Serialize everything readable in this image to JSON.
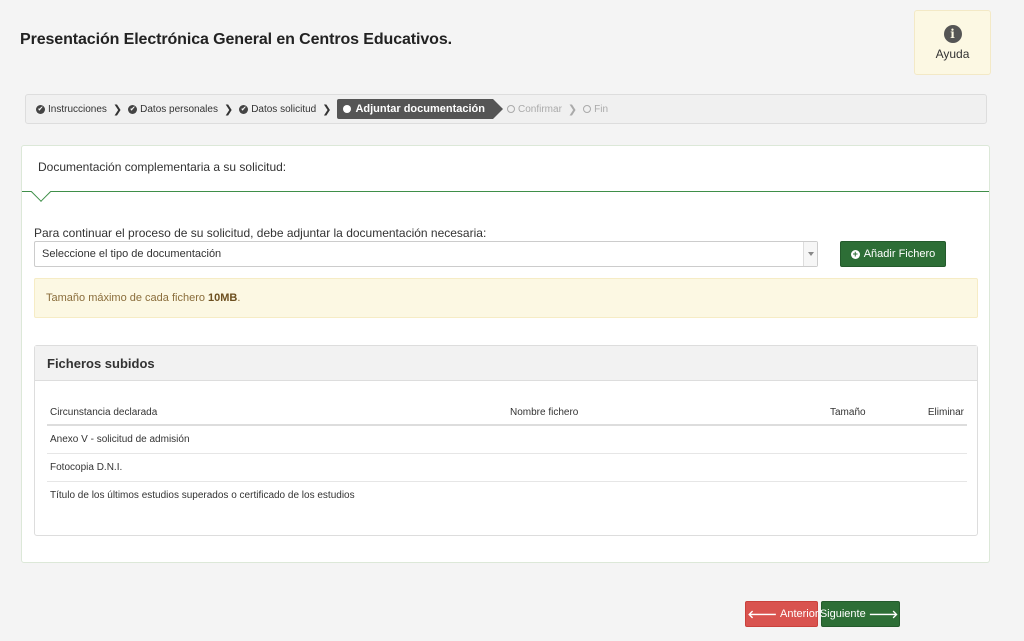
{
  "header": {
    "title": "Presentación Electrónica General en Centros Educativos.",
    "help_label": "Ayuda",
    "help_icon_glyph": "i"
  },
  "wizard": {
    "steps": [
      {
        "label": "Instrucciones",
        "state": "done"
      },
      {
        "label": "Datos personales",
        "state": "done"
      },
      {
        "label": "Datos solicitud",
        "state": "done"
      },
      {
        "label": "Adjuntar documentación",
        "state": "active"
      },
      {
        "label": "Confirmar",
        "state": "pending"
      },
      {
        "label": "Fin",
        "state": "pending"
      }
    ]
  },
  "panel": {
    "title": "Documentación complementaria a su solicitud:",
    "instructions": "Para continuar el proceso de su solicitud, debe adjuntar la documentación necesaria:",
    "select_value": "Seleccione el tipo de documentación",
    "add_button": "Añadir Fichero",
    "alert_prefix": "Tamaño máximo de cada fichero ",
    "alert_bold": "10MB",
    "alert_suffix": "."
  },
  "files": {
    "title": "Ficheros subidos",
    "columns": [
      "Circunstancia declarada",
      "Nombre fichero",
      "Tamaño",
      "Eliminar"
    ],
    "rows": [
      [
        "Anexo V - solicitud de admisión",
        "",
        "",
        ""
      ],
      [
        "Fotocopia D.N.I.",
        "",
        "",
        ""
      ],
      [
        "Título de los últimos estudios superados o certificado de los estudios",
        "",
        "",
        ""
      ]
    ]
  },
  "footer": {
    "prev_label": "Anterior",
    "next_label": "Siguiente"
  },
  "colors": {
    "primary_green": "#2d6e36",
    "danger_red": "#d9534f",
    "warning_bg": "#fcf8e3"
  }
}
